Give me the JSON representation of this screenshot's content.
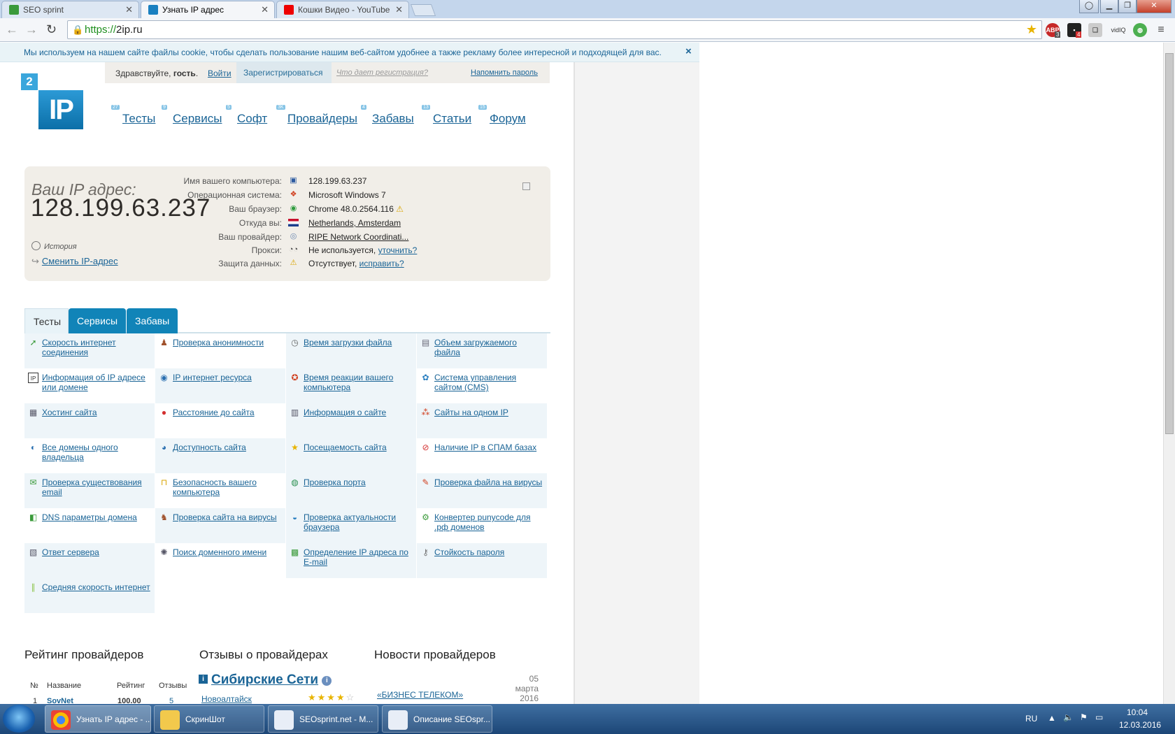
{
  "browser": {
    "tabs": [
      {
        "title": "SEO sprint",
        "active": false
      },
      {
        "title": "Узнать IP адрес",
        "active": true
      },
      {
        "title": "Кошки Видео - YouTube",
        "active": false
      }
    ],
    "url_protocol": "https://",
    "url_host": "2ip.ru",
    "extensions": [
      "ABP",
      "vidIQ"
    ],
    "extension_badges": [
      "3",
      "4"
    ]
  },
  "cookie_notice": {
    "text": "Мы используем на нашем сайте файлы cookie, чтобы сделать пользование нашим веб-сайтом удобнее а также рекламу более интересной и подходящей для вас.",
    "close": "×"
  },
  "userbar": {
    "greeting": "Здравствуйте, ",
    "guest": "гость",
    "login": "Войти",
    "register": "Зарегистрироваться",
    "why_register": "Что дает регистрация?",
    "remind": "Напомнить пароль"
  },
  "logo": {
    "digit": "2",
    "text": "IP"
  },
  "main_menu": [
    {
      "label": "Тесты",
      "badge": "27"
    },
    {
      "label": "Сервисы",
      "badge": "9"
    },
    {
      "label": "Софт",
      "badge": "5"
    },
    {
      "label": "Провайдеры",
      "badge": "3K"
    },
    {
      "label": "Забавы",
      "badge": "4"
    },
    {
      "label": "Статьи",
      "badge": "13"
    },
    {
      "label": "Форум",
      "badge": "15"
    }
  ],
  "ip_info": {
    "label": "Ваш IP адрес:",
    "ip": "128.199.63.237",
    "history": "История",
    "change_ip": "Сменить IP-адрес",
    "rows": [
      {
        "key": "Имя вашего компьютера:",
        "value": "128.199.63.237",
        "link": false
      },
      {
        "key": "Операционная система:",
        "value": "Microsoft Windows 7",
        "link": false
      },
      {
        "key": "Ваш браузер:",
        "value": "Chrome 48.0.2564.116",
        "link": false
      },
      {
        "key": "Откуда вы:",
        "value": "Netherlands, Amsterdam",
        "link": true
      },
      {
        "key": "Ваш провайдер:",
        "value": "RIPE Network Coordinati...",
        "link": true
      },
      {
        "key": "Прокси:",
        "value": "Не используется, ",
        "link_text": "уточнить?",
        "link": false
      },
      {
        "key": "Защита данных:",
        "value": "Отсутствует, ",
        "link_text": "исправить?",
        "link": false
      }
    ]
  },
  "section_tabs": [
    "Тесты",
    "Сервисы",
    "Забавы"
  ],
  "tests": [
    "Скорость интернет соединения",
    "Проверка анонимности",
    "Время загрузки файла",
    "Объем загружаемого файла",
    "Информация об IP адресе или домене",
    "IP интернет ресурса",
    "Время реакции вашего компьютера",
    "Система управления сайтом (CMS)",
    "Хостинг сайта",
    "Расстояние до сайта",
    "Информация о сайте",
    "Сайты на одном IP",
    "Все домены одного владельца",
    "Доступность сайта",
    "Посещаемость сайта",
    "Наличие IP в СПАМ базах",
    "Проверка существования email",
    "Безопасность вашего компьютера",
    "Проверка порта",
    "Проверка файла на вирусы",
    "DNS параметры домена",
    "Проверка сайта на вирусы",
    "Проверка актуальности браузера",
    "Конвертер punycode для .рф доменов",
    "Ответ сервера",
    "Поиск доменного имени",
    "Определение IP адреса по E-mail",
    "Стойкость пароля",
    "Средняя скорость интернет"
  ],
  "bottom": {
    "rating_title": "Рейтинг провайдеров",
    "reviews_title": "Отзывы о провайдерах",
    "news_title": "Новости провайдеров",
    "rating_headers": [
      "№",
      "Название",
      "Рейтинг",
      "Отзывы"
    ],
    "rating_row": [
      "1",
      "SovNet",
      "100.00",
      "5"
    ],
    "review_provider": "Сибирские Сети",
    "review_city": "Новоалтайск",
    "review_stars": 4,
    "news_day": "05",
    "news_month": "марта",
    "news_year": "2016",
    "news_title_item": "«БИЗНЕС ТЕЛЕКОМ»"
  },
  "taskbar": {
    "items": [
      "Узнать IP адрес - ...",
      "СкринШот",
      "SEOsprint.net - M...",
      "Описание SEOspr..."
    ],
    "lang": "RU",
    "time": "10:04",
    "date": "12.03.2016"
  }
}
